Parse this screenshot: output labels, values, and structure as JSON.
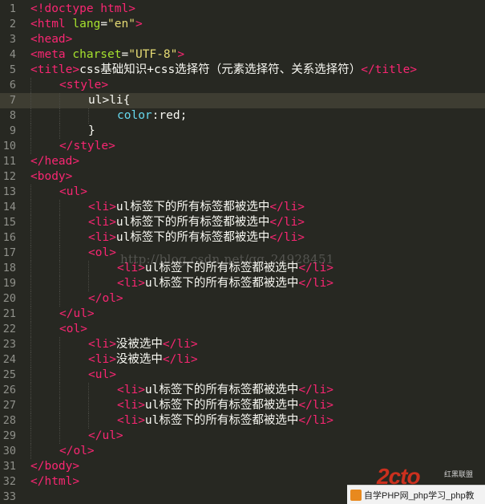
{
  "editor": {
    "current_line": 7,
    "lines": [
      {
        "n": "1",
        "indent": 0,
        "tokens": [
          [
            "tag",
            "<!doctype html>"
          ]
        ]
      },
      {
        "n": "2",
        "indent": 0,
        "tokens": [
          [
            "tag",
            "<html "
          ],
          [
            "attr",
            "lang"
          ],
          [
            "txt",
            "="
          ],
          [
            "str",
            "\"en\""
          ],
          [
            "tag",
            ">"
          ]
        ]
      },
      {
        "n": "3",
        "indent": 0,
        "tokens": [
          [
            "tag",
            "<head>"
          ]
        ]
      },
      {
        "n": "4",
        "indent": 0,
        "tokens": [
          [
            "tag",
            "<meta "
          ],
          [
            "attr",
            "charset"
          ],
          [
            "txt",
            "="
          ],
          [
            "str",
            "\"UTF-8\""
          ],
          [
            "tag",
            ">"
          ]
        ]
      },
      {
        "n": "5",
        "indent": 0,
        "tokens": [
          [
            "tag",
            "<title>"
          ],
          [
            "txt",
            "css基础知识+css选择符（元素选择符、关系选择符）"
          ],
          [
            "tag",
            "</title>"
          ]
        ]
      },
      {
        "n": "6",
        "indent": 1,
        "tokens": [
          [
            "tag",
            "<style>"
          ]
        ]
      },
      {
        "n": "7",
        "indent": 2,
        "tokens": [
          [
            "txt",
            "ul>li{"
          ]
        ]
      },
      {
        "n": "8",
        "indent": 3,
        "tokens": [
          [
            "prop",
            "color"
          ],
          [
            "txt",
            ":"
          ],
          [
            "txt",
            "red;"
          ]
        ]
      },
      {
        "n": "9",
        "indent": 2,
        "tokens": [
          [
            "txt",
            "}"
          ]
        ]
      },
      {
        "n": "10",
        "indent": 1,
        "tokens": [
          [
            "tag",
            "</style>"
          ]
        ]
      },
      {
        "n": "11",
        "indent": 0,
        "tokens": [
          [
            "tag",
            "</head>"
          ]
        ]
      },
      {
        "n": "12",
        "indent": 0,
        "tokens": [
          [
            "tag",
            "<body>"
          ]
        ]
      },
      {
        "n": "13",
        "indent": 1,
        "tokens": [
          [
            "tag",
            "<ul>"
          ]
        ]
      },
      {
        "n": "14",
        "indent": 2,
        "tokens": [
          [
            "tag",
            "<li>"
          ],
          [
            "txt",
            "ul标签下的所有标签都被选中"
          ],
          [
            "tag",
            "</li>"
          ]
        ]
      },
      {
        "n": "15",
        "indent": 2,
        "tokens": [
          [
            "tag",
            "<li>"
          ],
          [
            "txt",
            "ul标签下的所有标签都被选中"
          ],
          [
            "tag",
            "</li>"
          ]
        ]
      },
      {
        "n": "16",
        "indent": 2,
        "tokens": [
          [
            "tag",
            "<li>"
          ],
          [
            "txt",
            "ul标签下的所有标签都被选中"
          ],
          [
            "tag",
            "</li>"
          ]
        ]
      },
      {
        "n": "17",
        "indent": 2,
        "tokens": [
          [
            "tag",
            "<ol>"
          ]
        ]
      },
      {
        "n": "18",
        "indent": 3,
        "tokens": [
          [
            "tag",
            "<li>"
          ],
          [
            "txt",
            "ul标签下的所有标签都被选中"
          ],
          [
            "tag",
            "</li>"
          ]
        ]
      },
      {
        "n": "19",
        "indent": 3,
        "tokens": [
          [
            "tag",
            "<li>"
          ],
          [
            "txt",
            "ul标签下的所有标签都被选中"
          ],
          [
            "tag",
            "</li>"
          ]
        ]
      },
      {
        "n": "20",
        "indent": 2,
        "tokens": [
          [
            "tag",
            "</ol>"
          ]
        ]
      },
      {
        "n": "21",
        "indent": 1,
        "tokens": [
          [
            "tag",
            "</ul>"
          ]
        ]
      },
      {
        "n": "22",
        "indent": 1,
        "tokens": [
          [
            "tag",
            "<ol>"
          ]
        ]
      },
      {
        "n": "23",
        "indent": 2,
        "tokens": [
          [
            "tag",
            "<li>"
          ],
          [
            "txt",
            "没被选中"
          ],
          [
            "tag",
            "</li>"
          ]
        ]
      },
      {
        "n": "24",
        "indent": 2,
        "tokens": [
          [
            "tag",
            "<li>"
          ],
          [
            "txt",
            "没被选中"
          ],
          [
            "tag",
            "</li>"
          ]
        ]
      },
      {
        "n": "25",
        "indent": 2,
        "tokens": [
          [
            "tag",
            "<ul>"
          ]
        ]
      },
      {
        "n": "26",
        "indent": 3,
        "tokens": [
          [
            "tag",
            "<li>"
          ],
          [
            "txt",
            "ul标签下的所有标签都被选中"
          ],
          [
            "tag",
            "</li>"
          ]
        ]
      },
      {
        "n": "27",
        "indent": 3,
        "tokens": [
          [
            "tag",
            "<li>"
          ],
          [
            "txt",
            "ul标签下的所有标签都被选中"
          ],
          [
            "tag",
            "</li>"
          ]
        ]
      },
      {
        "n": "28",
        "indent": 3,
        "tokens": [
          [
            "tag",
            "<li>"
          ],
          [
            "txt",
            "ul标签下的所有标签都被选中"
          ],
          [
            "tag",
            "</li>"
          ]
        ]
      },
      {
        "n": "29",
        "indent": 2,
        "tokens": [
          [
            "tag",
            "</ul>"
          ]
        ]
      },
      {
        "n": "30",
        "indent": 1,
        "tokens": [
          [
            "tag",
            "</ol>"
          ]
        ]
      },
      {
        "n": "31",
        "indent": 0,
        "tokens": [
          [
            "tag",
            "</body>"
          ]
        ]
      },
      {
        "n": "32",
        "indent": 0,
        "tokens": [
          [
            "tag",
            "</html>"
          ]
        ]
      },
      {
        "n": "33",
        "indent": 0,
        "tokens": []
      }
    ]
  },
  "colors": {
    "background": "#272822",
    "tag": "#f92672",
    "attribute": "#a6e22e",
    "string": "#e6db74",
    "property": "#66d9ef",
    "text": "#f8f8f2",
    "line_number": "#8f908a"
  },
  "watermark": {
    "text": "http://blog.csdn.net/qq_24928451"
  },
  "logo": {
    "mark": "2cto",
    "caption": "红黑联盟"
  },
  "banner": {
    "icon": "php-icon",
    "text": "自学PHP网_php学习_php教"
  }
}
